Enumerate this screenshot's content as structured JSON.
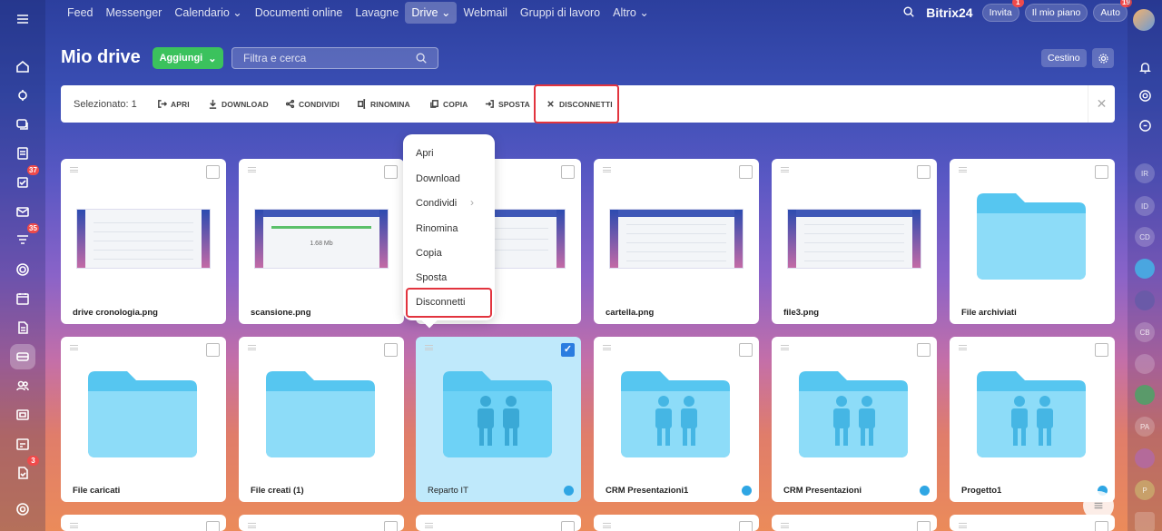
{
  "topbar": {
    "menu": [
      "Feed",
      "Messenger",
      "Calendario",
      "Documenti online",
      "Lavagne",
      "Drive",
      "Webmail",
      "Gruppi di lavoro",
      "Altro"
    ],
    "logo_text": "Bitrix",
    "logo_num": "24",
    "invite": "Invita",
    "invite_badge": "1",
    "plan": "Il mio piano",
    "auto": "Auto",
    "auto_badge": "19"
  },
  "leftnav": {
    "badges": {
      "tasks": "37",
      "feed": "35",
      "forms": "3"
    }
  },
  "rightpanel": [
    "IR",
    "ID",
    "CD",
    "CB",
    "PA",
    "P"
  ],
  "page": {
    "title": "Mio drive",
    "add_label": "Aggiungi",
    "search_placeholder": "Filtra e cerca",
    "trash_label": "Cestino"
  },
  "actionbar": {
    "selected": "Selezionato: 1",
    "actions": [
      "Apri",
      "Download",
      "Condividi",
      "Rinomina",
      "Copia",
      "Sposta",
      "Disconnetti"
    ]
  },
  "context_menu": [
    "Apri",
    "Download",
    "Condividi",
    "Rinomina",
    "Copia",
    "Sposta",
    "Disconnetti"
  ],
  "files_row1": [
    "drive cronologia.png",
    "scansione.png",
    "",
    "cartella.png",
    "file3.png",
    "File archiviati"
  ],
  "files_row2": [
    "File caricati",
    "File creati (1)",
    "Reparto IT",
    "CRM Presentazioni1",
    "CRM Presentazioni",
    "Progetto1"
  ],
  "thumb_text": "1.68 Mb",
  "colors": {
    "accent": "#3bc25d",
    "selected": "#bfe9fb",
    "highlight": "#e2343e",
    "folder": "#56c6f0"
  }
}
